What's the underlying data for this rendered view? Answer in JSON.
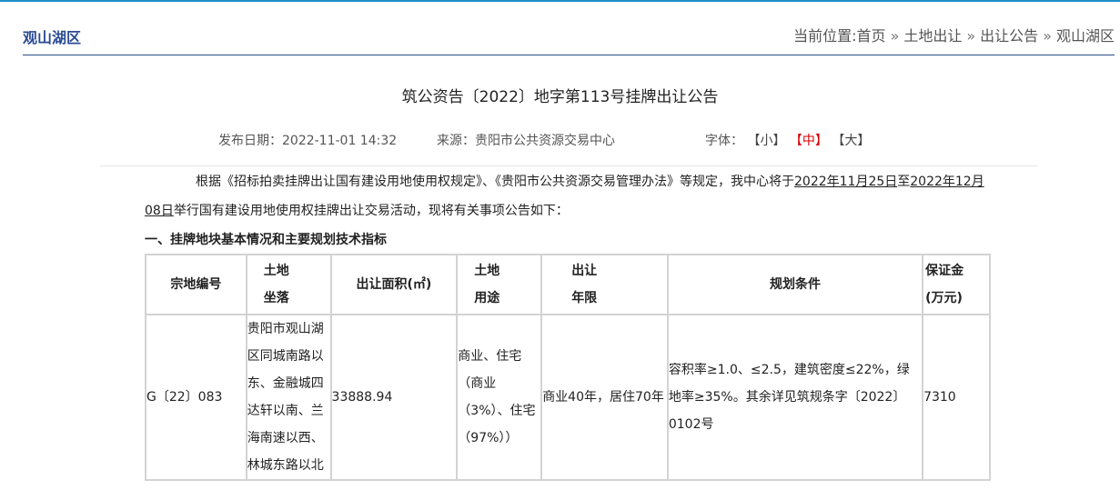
{
  "header": {
    "site_name": "观山湖区",
    "breadcrumb": {
      "prefix": "当前位置:",
      "items": [
        "首页",
        "土地出让",
        "出让公告",
        "观山湖区"
      ],
      "separator": "»"
    }
  },
  "article": {
    "title": "筑公资告〔2022〕地字第113号挂牌出让公告",
    "meta": {
      "date_label": "发布日期：",
      "date": "2022-11-01 14:32",
      "source_label": "来源：",
      "source": "贵阳市公共资源交易中心",
      "font_label": "字体：",
      "font_small": "【小】",
      "font_medium": "【中】",
      "font_large": "【大】"
    },
    "intro": {
      "text_before": "根据《招标拍卖挂牌出让国有建设用地使用权规定》、《贵阳市公共资源交易管理办法》等规定，我中心将于",
      "date_start": "2022年11月25日",
      "text_mid": "至",
      "date_end": "2022年12月08日",
      "text_after": "举行国有建设用地使用权挂牌出让交易活动，现将有关事项公告如下："
    },
    "section_title": "一、挂牌地块基本情况和主要规划技术指标",
    "table": {
      "headers": {
        "code": "宗地编号",
        "location_1": "土地",
        "location_2": "坐落",
        "area": "出让面积(㎡)",
        "usage_1": "土地",
        "usage_2": "用途",
        "term_1": "出让",
        "term_2": "年限",
        "planning": "规划条件",
        "deposit_1": "保证金",
        "deposit_2": "(万元)"
      },
      "rows": [
        {
          "code": "G〔22〕083",
          "location": "贵阳市观山湖区同城南路以东、金融城四达轩以南、兰海南速以西、林城东路以北",
          "area": "33888.94",
          "usage": "商业、住宅（商业（3%）、住宅（97%））",
          "term": "商业40年，居住70年",
          "planning": "容积率≥1.0、≤2.5，建筑密度≤22%，绿地率≥35%。其余详见筑规条字〔2022〕0102号",
          "deposit": "7310"
        }
      ]
    }
  }
}
